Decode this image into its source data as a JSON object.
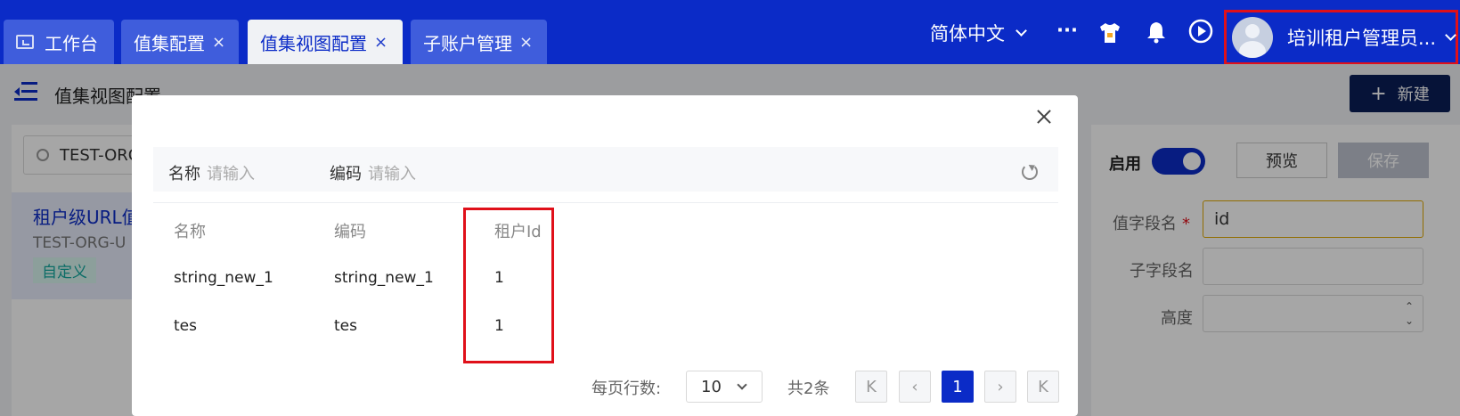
{
  "tabs": [
    {
      "label": "工作台",
      "closable": false,
      "active": false,
      "icon": "monitor-icon"
    },
    {
      "label": "值集配置",
      "closable": true,
      "active": false
    },
    {
      "label": "值集视图配置",
      "closable": true,
      "active": true
    },
    {
      "label": "子账户管理",
      "closable": true,
      "active": false
    }
  ],
  "tab_close_glyph": "×",
  "header": {
    "language": "简体中文",
    "more": "···",
    "user_name": "培训租户管理员...",
    "icons": [
      "tshirt-icon",
      "bell-icon",
      "play-circle-icon",
      "avatar-icon"
    ]
  },
  "page": {
    "title": "值集视图配置",
    "new_button": "新建",
    "search_value": "TEST-ORG",
    "list_item": {
      "title": "租户级URL值",
      "code": "TEST-ORG-U",
      "tag": "自定义"
    },
    "enable_label": "启用",
    "preview_button": "预览",
    "save_button": "保存",
    "fields": [
      {
        "label": "值字段名",
        "value": "id",
        "required": true
      },
      {
        "label": "子字段名",
        "value": ""
      },
      {
        "label": "高度",
        "value": ""
      }
    ]
  },
  "modal": {
    "filters": [
      {
        "label": "名称",
        "placeholder": "请输入"
      },
      {
        "label": "编码",
        "placeholder": "请输入"
      }
    ],
    "columns": [
      "名称",
      "编码",
      "租户Id"
    ],
    "rows": [
      [
        "string_new_1",
        "string_new_1",
        "1"
      ],
      [
        "tes",
        "tes",
        "1"
      ]
    ],
    "pagination": {
      "rows_per_page_label": "每页行数:",
      "rows_per_page": "10",
      "total": "共2条",
      "current_page": "1"
    }
  },
  "colors": {
    "brand": "#0b2bc7",
    "highlight": "#e0101a"
  }
}
